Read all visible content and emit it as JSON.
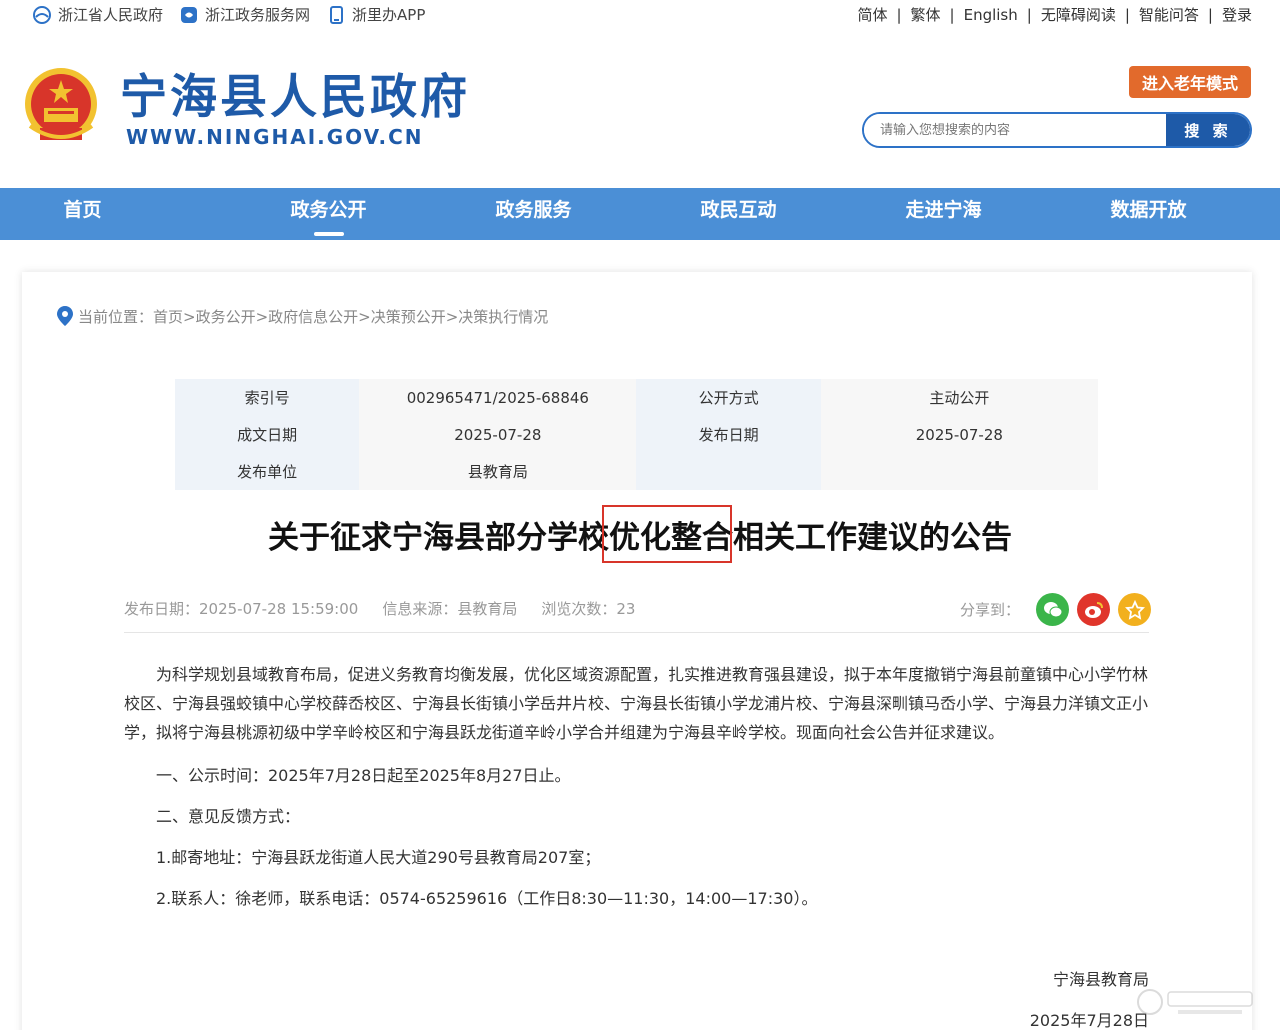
{
  "topbar": {
    "left": [
      "浙江省人民政府",
      "浙江政务服务网",
      "浙里办APP"
    ],
    "right": [
      "简体",
      "繁体",
      "English",
      "无障碍阅读",
      "智能问答",
      "登录"
    ],
    "sep": "|"
  },
  "header": {
    "title": "宁海县人民政府",
    "url": "WWW.NINGHAI.GOV.CN",
    "elder_mode": "进入老年模式",
    "search_placeholder": "请输入您想搜索的内容",
    "search_button": "搜 索"
  },
  "nav": [
    "首页",
    "政务公开",
    "政务服务",
    "政民互动",
    "走进宁海",
    "数据开放"
  ],
  "breadcrumb": "当前位置：首页>政务公开>政府信息公开>决策预公开>决策执行情况",
  "meta": {
    "index_label": "索引号",
    "index_value": "002965471/2025-68846",
    "method_label": "公开方式",
    "method_value": "主动公开",
    "created_label": "成文日期",
    "created_value": "2025-07-28",
    "published_label": "发布日期",
    "published_value": "2025-07-28",
    "unit_label": "发布单位",
    "unit_value": "县教育局"
  },
  "article": {
    "title": "关于征求宁海县部分学校优化整合相关工作建议的公告",
    "publish": "发布日期：2025-07-28 15:59:00",
    "source": "信息来源：县教育局",
    "views": "浏览次数：23",
    "share_label": "分享到：",
    "paragraph": "为科学规划县域教育布局，促进义务教育均衡发展，优化区域资源配置，扎实推进教育强县建设，拟于本年度撤销宁海县前童镇中心小学竹林校区、宁海县强蛟镇中心学校薛岙校区、宁海县长街镇小学岳井片校、宁海县长街镇小学龙浦片校、宁海县深甽镇马岙小学、宁海县力洋镇文正小学，拟将宁海县桃源初级中学辛岭校区和宁海县跃龙街道辛岭小学合并组建为宁海县辛岭学校。现面向社会公告并征求建议。",
    "line1": "一、公示时间：2025年7月28日起至2025年8月27日止。",
    "line2": "二、意见反馈方式：",
    "line3": "1.邮寄地址：宁海县跃龙街道人民大道290号县教育局207室；",
    "line4": "2.联系人：徐老师，联系电话：0574-65259616（工作日8:30—11:30，14:00—17:30）。",
    "sign_org": "宁海县教育局",
    "sign_date": "2025年7月28日"
  },
  "colors": {
    "brand_blue": "#1e5aa8",
    "nav_blue": "#4b8fd6",
    "elder_orange": "#e26a2c",
    "highlight_red": "#d8352a",
    "wechat_green": "#3bb54a",
    "weibo_red": "#e0352b",
    "favorite_yellow": "#f2b01e"
  },
  "icons": [
    "zhejiang-gov-icon",
    "zhejiang-service-icon",
    "zheliban-app-icon",
    "national-emblem",
    "location-icon",
    "wechat-icon",
    "weibo-icon",
    "favorite-icon"
  ]
}
